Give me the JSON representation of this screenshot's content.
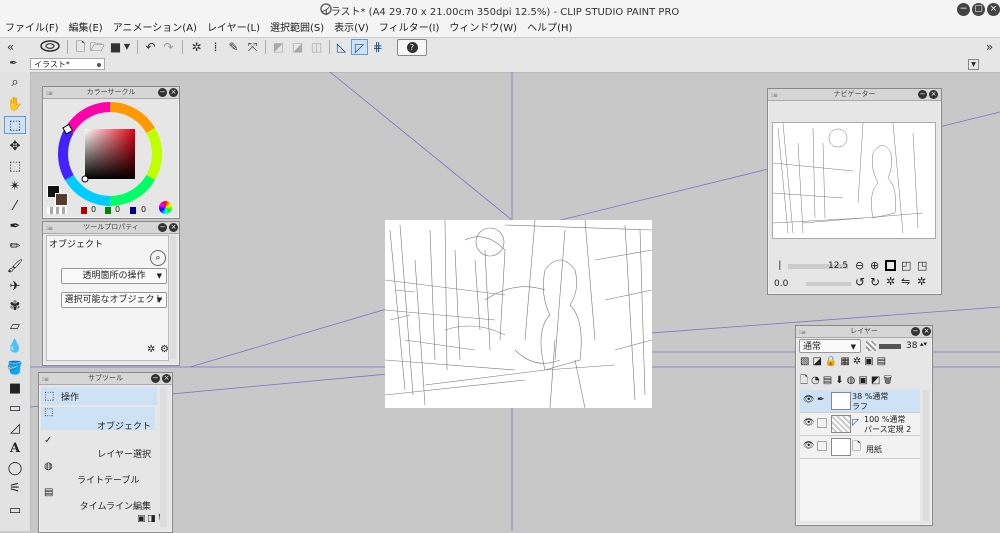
{
  "window": {
    "title": "イラスト* (A4 29.70 x 21.00cm 350dpi 12.5%) - CLIP STUDIO PAINT PRO",
    "controls": [
      "minimize",
      "restore",
      "close"
    ]
  },
  "menu": [
    "ファイル(F)",
    "編集(E)",
    "アニメーション(A)",
    "レイヤー(L)",
    "選択範囲(S)",
    "表示(V)",
    "フィルター(I)",
    "ウィンドウ(W)",
    "ヘルプ(H)"
  ],
  "document_tab": {
    "label": "イラスト*"
  },
  "panels": {
    "color_circle": {
      "title": "カラーサークル",
      "values": [
        "0",
        "0",
        "0"
      ]
    },
    "tool_property": {
      "title": "ツールプロパティ",
      "tool_name": "オブジェクト",
      "dropdown1": "透明箇所の操作",
      "dropdown2": "選択可能なオブジェクト"
    },
    "sub_tool": {
      "title": "サブツール",
      "group_label": "操作",
      "items": [
        "オブジェクト",
        "レイヤー選択",
        "ライトテーブル",
        "タイムライン編集"
      ]
    },
    "navigator": {
      "title": "ナビゲーター",
      "zoom": "12.5",
      "rotation": "0.0"
    },
    "layer": {
      "title": "レイヤー",
      "blend_mode": "通常",
      "opacity": "38",
      "layers": [
        {
          "line1": "38 %通常",
          "line2": "ラフ"
        },
        {
          "line1": "100 %通常",
          "line2": "パース定規 2"
        },
        {
          "line1": "",
          "line2": "用紙"
        }
      ]
    }
  },
  "icons": {
    "toolbox": [
      "zoom-icon",
      "hand-icon",
      "operation-icon",
      "move-layer-icon",
      "selection-icon",
      "auto-select-icon",
      "eyedropper-icon",
      "pen-icon",
      "pencil-icon",
      "brush-icon",
      "airbrush-icon",
      "decoration-icon",
      "eraser-icon",
      "blend-icon",
      "fill-icon",
      "gradient-icon",
      "figure-icon",
      "ruler-icon",
      "text-icon",
      "balloon-icon",
      "correction-icon"
    ]
  }
}
